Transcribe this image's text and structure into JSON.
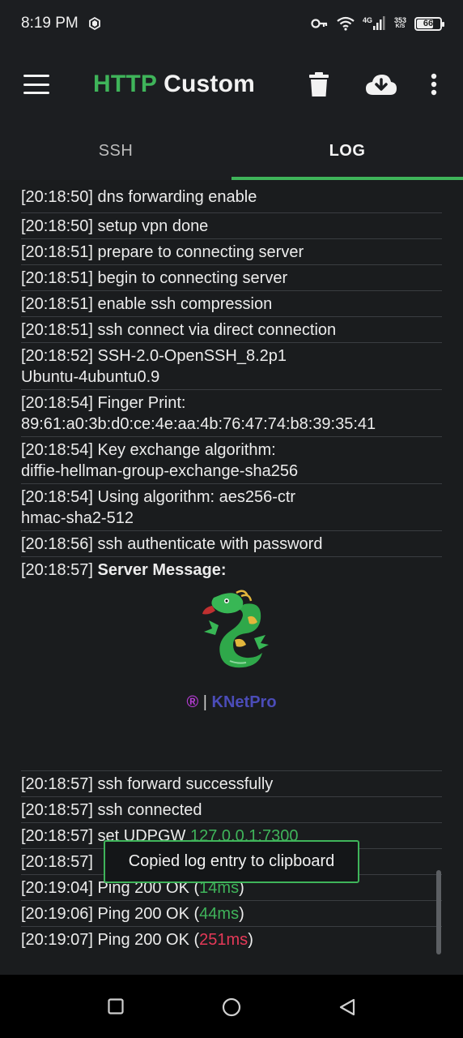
{
  "status_bar": {
    "time": "8:19 PM",
    "network": "4G",
    "speed_value": "353",
    "speed_unit": "K/S",
    "battery": "66"
  },
  "app_bar": {
    "title_part1": "HTTP",
    "title_part2": "Custom",
    "icons": [
      "menu-icon",
      "trash-icon",
      "cloud-download-icon",
      "more-vert-icon"
    ]
  },
  "tabs": [
    {
      "label": "SSH",
      "active": false
    },
    {
      "label": "LOG",
      "active": true
    }
  ],
  "log": {
    "entries": [
      {
        "time": "[20:18:50]",
        "text": "dns forwarding enable"
      },
      {
        "time": "[20:18:50]",
        "text": "setup vpn done"
      },
      {
        "time": "[20:18:51]",
        "text": "prepare to connecting server"
      },
      {
        "time": "[20:18:51]",
        "text": "begin to connecting server"
      },
      {
        "time": "[20:18:51]",
        "text": "enable ssh compression"
      },
      {
        "time": "[20:18:51]",
        "text": "ssh connect via direct connection"
      },
      {
        "time": "[20:18:52]",
        "text": "SSH-2.0-OpenSSH_8.2p1",
        "line2": "Ubuntu-4ubuntu0.9"
      },
      {
        "time": "[20:18:54]",
        "text": "Finger Print:",
        "line2": "89:61:a0:3b:d0:ce:4e:aa:4b:76:47:74:b8:39:35:41"
      },
      {
        "time": "[20:18:54]",
        "text": "Key exchange algorithm:",
        "line2": "diffie-hellman-group-exchange-sha256"
      },
      {
        "time": "[20:18:54]",
        "text": "Using algorithm: aes256-ctr",
        "line2": "hmac-sha2-512"
      },
      {
        "time": "[20:18:56]",
        "text": "ssh authenticate with password"
      },
      {
        "time": "[20:18:57]",
        "text": "Server Message:",
        "brand_reg": "®",
        "brand_sep": "|",
        "brand_name": "KNetPro"
      },
      {
        "time": "[20:18:57]",
        "text": "ssh forward successfully"
      },
      {
        "time": "[20:18:57]",
        "text": "ssh connected"
      },
      {
        "time": "[20:18:57]",
        "text": "set UDPGW",
        "value": "127.0.0.1:7300"
      },
      {
        "time": "[20:18:57]",
        "text": ""
      },
      {
        "time": "[20:19:04]",
        "text": "Ping 200 OK (",
        "value": "14ms",
        "suffix": ")"
      },
      {
        "time": "[20:19:06]",
        "text": "Ping 200 OK (",
        "value": "44ms",
        "suffix": ")"
      },
      {
        "time": "[20:19:07]",
        "text": "Ping 200 OK (",
        "value": "251ms",
        "suffix": ")"
      }
    ]
  },
  "toast": {
    "text": "Copied log entry to clipboard"
  },
  "colors": {
    "accent": "#3fb45a",
    "ping_bad": "#e53958",
    "brand_reg": "#b33cd1",
    "brand_name": "#4b4cb8"
  },
  "nav_bar": {
    "icons": [
      "recents-icon",
      "home-icon",
      "back-icon"
    ]
  }
}
